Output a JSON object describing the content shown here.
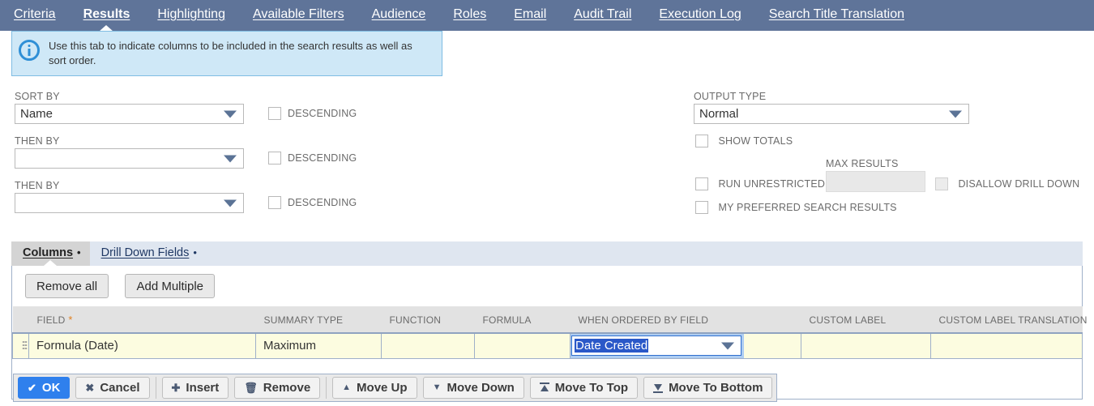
{
  "tabs": [
    {
      "label": "Criteria",
      "active": false
    },
    {
      "label": "Results",
      "active": true
    },
    {
      "label": "Highlighting",
      "active": false
    },
    {
      "label": "Available Filters",
      "active": false
    },
    {
      "label": "Audience",
      "active": false
    },
    {
      "label": "Roles",
      "active": false
    },
    {
      "label": "Email",
      "active": false
    },
    {
      "label": "Audit Trail",
      "active": false
    },
    {
      "label": "Execution Log",
      "active": false
    },
    {
      "label": "Search Title Translation",
      "active": false
    }
  ],
  "banner": {
    "icon": "info-icon",
    "text": "Use this tab to indicate columns to be included in the search results as well as sort order."
  },
  "sort": {
    "primary_label": "SORT BY",
    "primary_value": "Name",
    "secondary_label": "THEN BY",
    "secondary_value": "",
    "tertiary_label": "THEN BY",
    "tertiary_value": "",
    "descending_label": "DESCENDING",
    "desc1_checked": false,
    "desc2_checked": false,
    "desc3_checked": false
  },
  "output": {
    "type_label": "OUTPUT TYPE",
    "type_value": "Normal",
    "show_totals_label": "SHOW TOTALS",
    "show_totals_checked": false,
    "max_results_label": "MAX RESULTS",
    "max_results_value": "",
    "run_unrestricted_label": "RUN UNRESTRICTED",
    "run_unrestricted_checked": false,
    "disallow_drill_down_label": "DISALLOW DRILL DOWN",
    "disallow_drill_down_checked": false,
    "disallow_drill_down_disabled": true,
    "my_preferred_label": "MY PREFERRED SEARCH RESULTS",
    "my_preferred_checked": false
  },
  "sublist": {
    "tabs": [
      {
        "label": "Columns",
        "active": true,
        "dot": "•"
      },
      {
        "label": "Drill Down Fields",
        "active": false,
        "dot": "•"
      }
    ],
    "toolbar": {
      "remove_all_label": "Remove all",
      "add_multiple_label": "Add Multiple"
    },
    "columns": [
      {
        "label": "FIELD",
        "required": "*"
      },
      {
        "label": "SUMMARY TYPE",
        "required": ""
      },
      {
        "label": "FUNCTION",
        "required": ""
      },
      {
        "label": "FORMULA",
        "required": ""
      },
      {
        "label": "WHEN ORDERED BY FIELD",
        "required": ""
      },
      {
        "label": "CUSTOM LABEL",
        "required": ""
      },
      {
        "label": "CUSTOM LABEL TRANSLATION",
        "required": ""
      }
    ],
    "rows": [
      {
        "handle": "drag-handle-icon",
        "field": "Formula (Date)",
        "summary_type": "Maximum",
        "function": "",
        "formula": "",
        "when_ordered_by_field": "Date Created",
        "when_ordered_by_field_focused": true,
        "custom_label": "",
        "custom_label_translation": ""
      }
    ]
  },
  "buttons": [
    {
      "label": "OK",
      "icon": "check-icon",
      "glyph": "✔",
      "primary": true
    },
    {
      "label": "Cancel",
      "icon": "close-icon",
      "glyph": "✖",
      "primary": false
    },
    {
      "label": "Insert",
      "icon": "plus-icon",
      "glyph": "✚",
      "primary": false
    },
    {
      "label": "Remove",
      "icon": "trash-icon",
      "glyph": "🗑",
      "primary": false
    },
    {
      "label": "Move Up",
      "icon": "arrow-up-icon",
      "glyph": "▲",
      "primary": false
    },
    {
      "label": "Move Down",
      "icon": "arrow-down-icon",
      "glyph": "▼",
      "primary": false
    },
    {
      "label": "Move To Top",
      "icon": "arrow-to-top-icon",
      "glyph": "",
      "primary": false
    },
    {
      "label": "Move To Bottom",
      "icon": "arrow-to-bottom-icon",
      "glyph": "",
      "primary": false
    }
  ],
  "colors": {
    "tabbar": "#5f7499",
    "banner_bg": "#cfe8f7",
    "banner_border": "#7fbde3",
    "row_bg": "#fcfce0",
    "primary_button": "#2f80ed",
    "focus_ring": "#aecdf2",
    "selection": "#2a58c8",
    "required_star": "#e08020"
  }
}
